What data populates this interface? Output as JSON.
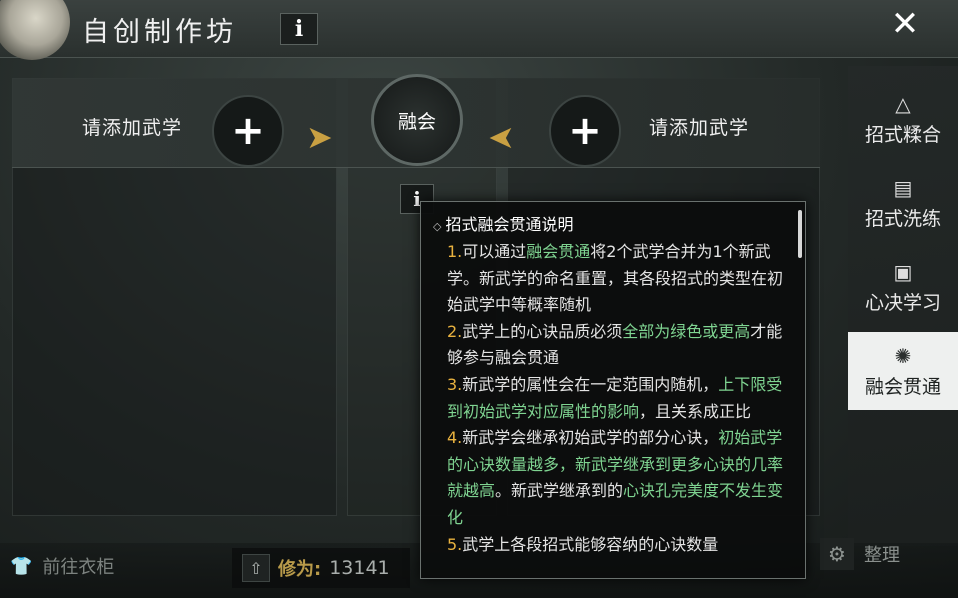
{
  "header": {
    "title": "自创制作坊",
    "info_glyph": "i",
    "close_glyph": "✕"
  },
  "slots": {
    "left_label": "请添加武学",
    "right_label": "请添加武学",
    "plus_glyph": "+",
    "center_label": "融会",
    "info_glyph": "i"
  },
  "nav": [
    {
      "label": "招式糅合",
      "icon": "triangle-nodes-icon",
      "glyph": "△"
    },
    {
      "label": "招式洗练",
      "icon": "scroll-icon",
      "glyph": "▤"
    },
    {
      "label": "心决学习",
      "icon": "scroll-add-icon",
      "glyph": "▣"
    },
    {
      "label": "融会贯通",
      "icon": "swirl-icon",
      "glyph": "✺",
      "active": true
    }
  ],
  "bottom": {
    "wardrobe_label": "前往衣柜",
    "cultivation_label": "修为:",
    "cultivation_value": "13141",
    "organize_label": "整理"
  },
  "tooltip": {
    "title": "招式融会贯通说明",
    "paragraphs": [
      [
        {
          "t": "1.",
          "c": "num"
        },
        {
          "t": "可以通过"
        },
        {
          "t": "融会贯通",
          "c": "hl"
        },
        {
          "t": "将2个武学合并为1个新武学。新武学的命名重置，其各段招式的类型在初始武学中等概率随机"
        }
      ],
      [
        {
          "t": "2.",
          "c": "num"
        },
        {
          "t": "武学上的心诀品质必须"
        },
        {
          "t": "全部为绿色或更高",
          "c": "hl"
        },
        {
          "t": "才能够参与融会贯通"
        }
      ],
      [
        {
          "t": "3.",
          "c": "num"
        },
        {
          "t": "新武学的属性会在一定范围内随机，"
        },
        {
          "t": "上下限受到初始武学对应属性的影响",
          "c": "hl"
        },
        {
          "t": "，且关系成正比"
        }
      ],
      [
        {
          "t": "4.",
          "c": "num"
        },
        {
          "t": "新武学会继承初始武学的部分心诀，"
        },
        {
          "t": "初始武学的心诀数量越多，新武学继承到更多心诀的几率就越高",
          "c": "hl"
        },
        {
          "t": "。新武学继承到的"
        },
        {
          "t": "心诀孔完美度不发生变化",
          "c": "hl"
        }
      ],
      [
        {
          "t": "5.",
          "c": "num"
        },
        {
          "t": "武学上各段招式能够容纳的心诀数量"
        }
      ]
    ]
  },
  "colors": {
    "accent_gold": "#e9b23f",
    "highlight_green": "#7fd491",
    "arrow_gold": "#c9a042"
  }
}
